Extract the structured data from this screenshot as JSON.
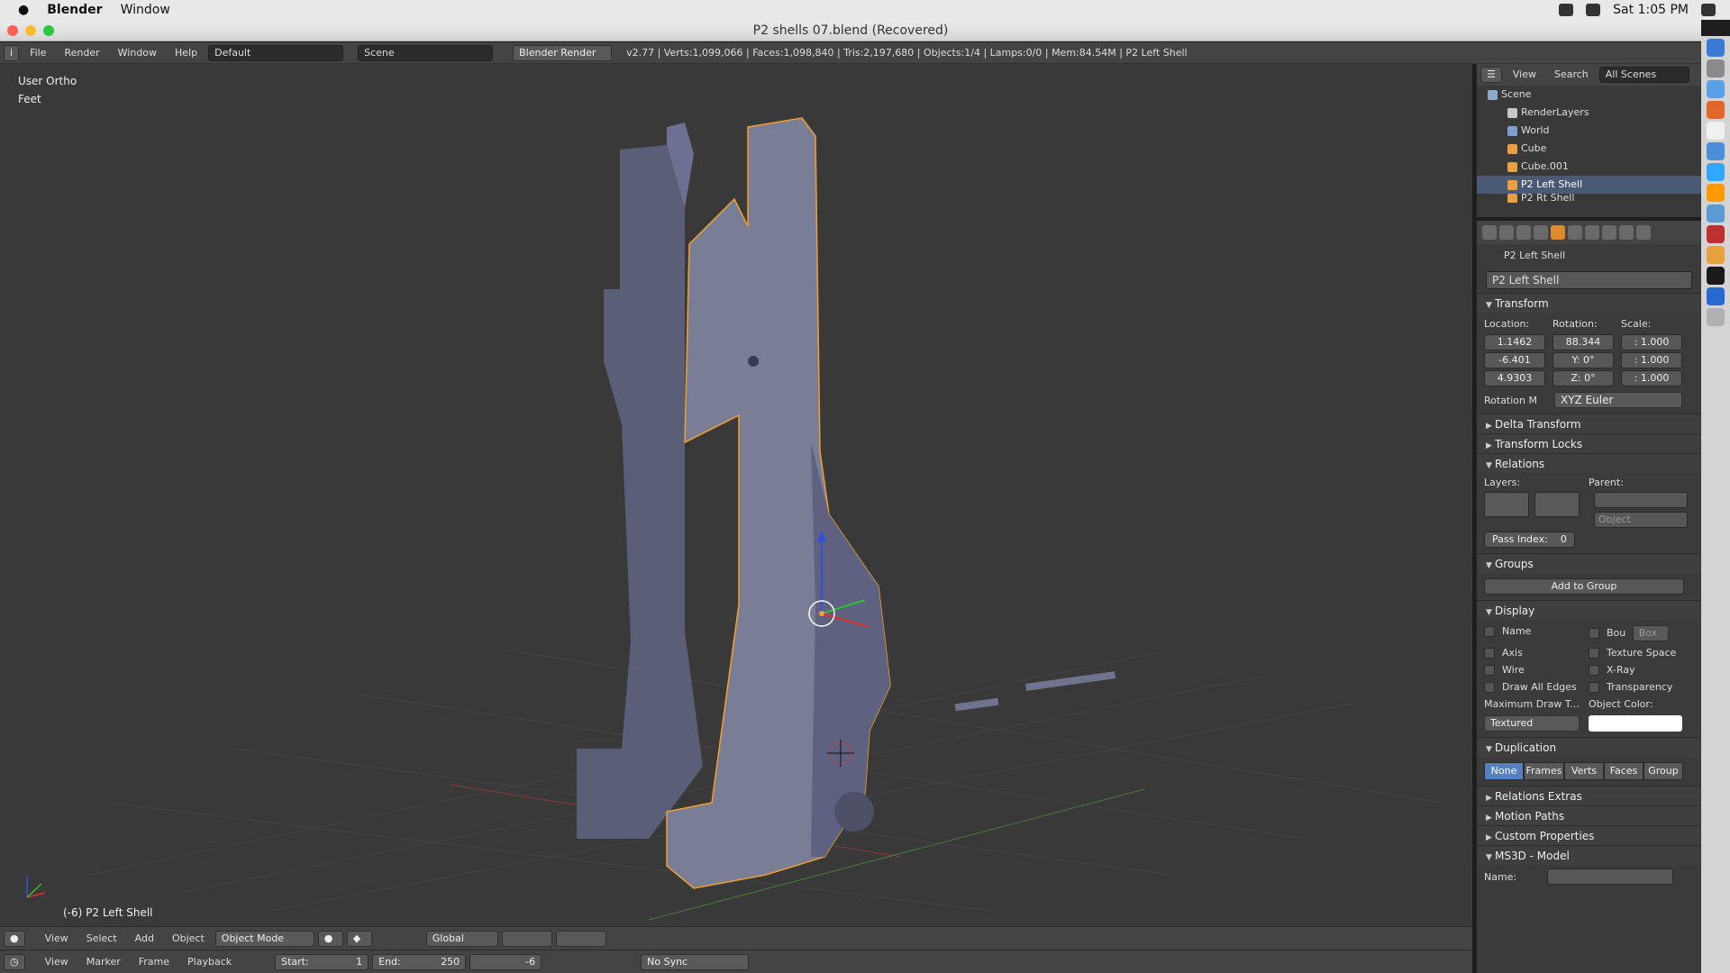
{
  "macbar": {
    "app": "Blender",
    "menu_window": "Window",
    "clock": "Sat 1:05 PM"
  },
  "window": {
    "title": "P2 shells 07.blend (Recovered)"
  },
  "header": {
    "menus": [
      "File",
      "Render",
      "Window",
      "Help"
    ],
    "layout": "Default",
    "scene": "Scene",
    "engine": "Blender Render",
    "stats": "v2.77 | Verts:1,099,066 | Faces:1,098,840 | Tris:2,197,680 | Objects:1/4 | Lamps:0/0 | Mem:84.54M | P2 Left Shell"
  },
  "viewport": {
    "view_name": "User Ortho",
    "units": "Feet",
    "object_label": "(-6) P2 Left Shell"
  },
  "viewport_header": {
    "menus": [
      "View",
      "Select",
      "Add",
      "Object"
    ],
    "mode": "Object Mode",
    "orientation": "Global"
  },
  "timeline": {
    "menus": [
      "View",
      "Marker",
      "Frame",
      "Playback"
    ],
    "start": "Start:",
    "start_val": "1",
    "end": "End:",
    "end_val": "250",
    "current": "-6",
    "sync": "No Sync"
  },
  "outliner": {
    "menus": [
      "View",
      "Search"
    ],
    "filter": "All Scenes",
    "items": [
      {
        "name": "Scene",
        "color": "#8fa8c8"
      },
      {
        "name": "RenderLayers",
        "color": "#c8c8c8"
      },
      {
        "name": "World",
        "color": "#7da0d0"
      },
      {
        "name": "Cube",
        "color": "#e8a040"
      },
      {
        "name": "Cube.001",
        "color": "#e8a040"
      },
      {
        "name": "P2 Left Shell",
        "color": "#e8a040"
      },
      {
        "name": "P2 Rt Shell",
        "color": "#e8a040"
      }
    ]
  },
  "properties": {
    "breadcrumb": "P2 Left Shell",
    "object_name": "P2 Left Shell",
    "transform": {
      "title": "Transform",
      "location_label": "Location:",
      "rotation_label": "Rotation:",
      "scale_label": "Scale:",
      "location": [
        "1.1462",
        "-6.401",
        "4.9303"
      ],
      "rotation": [
        "88.344",
        "Y:   0°",
        "Z:   0°"
      ],
      "scale": [
        ": 1.000",
        ": 1.000",
        ": 1.000"
      ],
      "rotation_mode_label": "Rotation M",
      "rotation_mode": "XYZ Euler"
    },
    "delta": "Delta Transform",
    "locks": "Transform Locks",
    "relations": {
      "title": "Relations",
      "layers": "Layers:",
      "parent": "Parent:",
      "parent_type": "Object",
      "pass_index": "Pass Index:",
      "pass_val": "0"
    },
    "groups": {
      "title": "Groups",
      "add": "Add to Group"
    },
    "display": {
      "title": "Display",
      "name": "Name",
      "bou": "Bou",
      "box": "Box",
      "axis": "Axis",
      "texture_space": "Texture Space",
      "wire": "Wire",
      "xray": "X-Ray",
      "draw_all_edges": "Draw All Edges",
      "transparency": "Transparency",
      "max_draw": "Maximum Draw T...",
      "object_color": "Object Color:",
      "draw_type": "Textured"
    },
    "duplication": {
      "title": "Duplication",
      "options": [
        "None",
        "Frames",
        "Verts",
        "Faces",
        "Group"
      ]
    },
    "relations_extras": "Relations Extras",
    "motion_paths": "Motion Paths",
    "custom_props": "Custom Properties",
    "ms3d": "MS3D - Model",
    "name_label": "Name:"
  }
}
